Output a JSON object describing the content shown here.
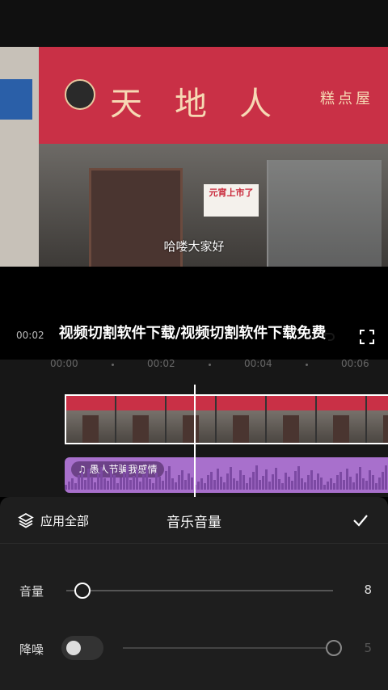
{
  "preview": {
    "shop_sign": "天地人",
    "shop_sub": "糕点屋",
    "poster_title": "元宵上市了",
    "subtitle": "哈喽大家好"
  },
  "player": {
    "timecode": "00:02",
    "overlay_title": "视频切割软件下载/视频切割软件下载免费"
  },
  "timeline": {
    "ruler": [
      "00:00",
      "00:02",
      "00:04",
      "00:06"
    ],
    "audio_clip_label": "愚人节骗我感情"
  },
  "sheet": {
    "apply_all_label": "应用全部",
    "title": "音乐音量",
    "volume_label": "音量",
    "volume_value": "8",
    "volume_level": 0.03,
    "denoise_label": "降噪",
    "denoise_value": "5",
    "denoise_enabled": false
  },
  "colors": {
    "accent": "#a870cc",
    "banner_red": "#c93046"
  },
  "icons": [
    "layers-icon",
    "check-icon",
    "fullscreen-icon",
    "undo-icon",
    "music-note-icon"
  ]
}
